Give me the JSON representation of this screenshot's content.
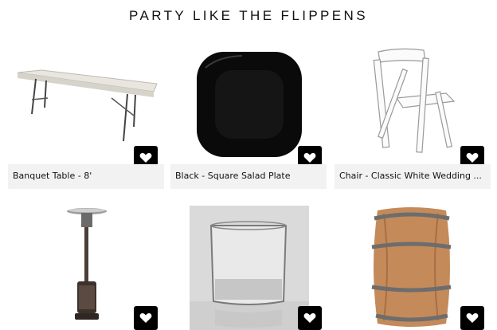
{
  "header": {
    "title": "PARTY LIKE THE FLIPPENS"
  },
  "products": [
    {
      "label": "Banquet Table - 8'",
      "image": "folding-table"
    },
    {
      "label": "Black - Square Salad Plate",
      "image": "black-square-plate"
    },
    {
      "label": "Chair - Classic White Wedding ...",
      "image": "white-folding-chair"
    },
    {
      "label": "",
      "image": "patio-heater"
    },
    {
      "label": "",
      "image": "rocks-glass"
    },
    {
      "label": "",
      "image": "wine-barrel"
    }
  ],
  "icons": {
    "favorite": "heart-icon"
  },
  "colors": {
    "favorite_button": "#000000",
    "caption_bg": "#f2f2f2",
    "text": "#111111"
  }
}
